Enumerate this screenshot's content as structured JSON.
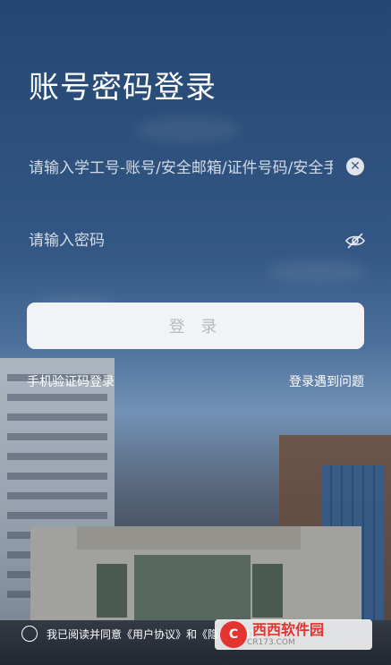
{
  "login": {
    "title": "账号密码登录",
    "username_placeholder": "请输入学工号-账号/安全邮箱/证件号码/安全手机",
    "password_placeholder": "请输入密码",
    "clear_icon": "clear-icon",
    "eye_icon": "eye-off-icon",
    "submit_label": "登 录",
    "sms_login_link": "手机验证码登录",
    "help_link": "登录遇到问题",
    "agreement_text": "我已阅读并同意《用户协议》和《隐私政策》"
  },
  "colors": {
    "button_bg": "#f2f3f5",
    "button_text": "#b7bac0",
    "text": "#ffffff"
  },
  "watermark": {
    "brand": "西西软件园",
    "site": "CR173.COM"
  }
}
